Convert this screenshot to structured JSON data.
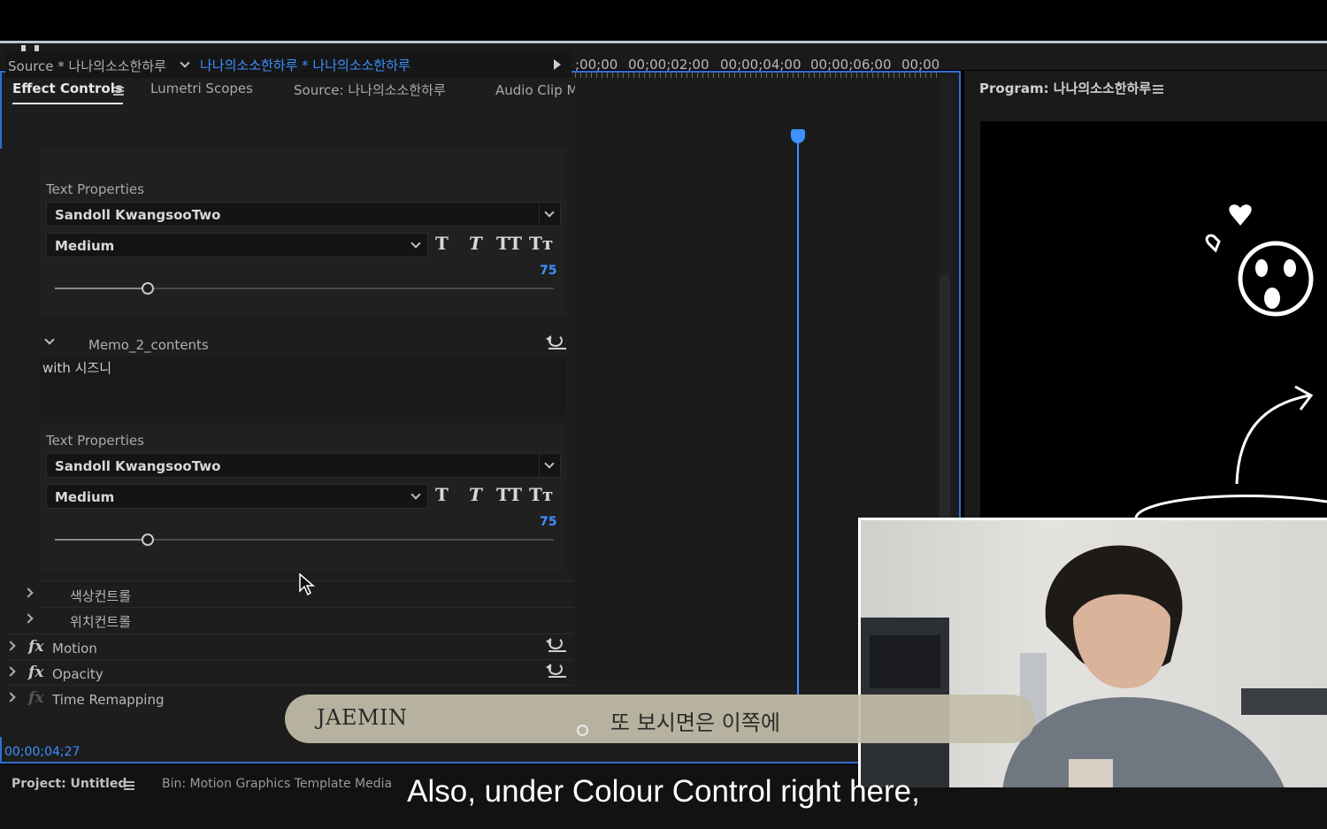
{
  "tabs": {
    "effect_controls": "Effect Controls",
    "lumetri": "Lumetri Scopes",
    "source": "Source: 나나의소소한하루",
    "audio_mixer": "Audio Clip Mixer: 나나의소소한하루"
  },
  "source_row": {
    "source_label": "Source * 나나의소소한하루",
    "sequence_label": "나나의소소한하루 * 나나의소소한하루"
  },
  "ruler": {
    "tc0": ";00;00",
    "tc1": "00;00;02;00",
    "tc2": "00;00;04;00",
    "tc3": "00;00;06;00",
    "tc4": "00;00"
  },
  "memo1": {
    "text_properties": "Text Properties",
    "font": "Sandoll KwangsooTwo",
    "style": "Medium",
    "size": "75"
  },
  "memo2": {
    "label": "Memo_2_contents",
    "content": "with 시즈니",
    "text_properties": "Text Properties",
    "font": "Sandoll KwangsooTwo",
    "style": "Medium",
    "size": "75"
  },
  "format_buttons": {
    "bold": "T",
    "italic": "T",
    "all_caps": "TT",
    "small_caps": "Tт"
  },
  "groups": {
    "color_control": "색상컨트롤",
    "position_control": "위치컨트롤"
  },
  "effects": {
    "fx": "fx",
    "motion": "Motion",
    "opacity": "Opacity",
    "time_remapping": "Time Remapping"
  },
  "status": {
    "timecode": "00;00;04;27"
  },
  "bottom": {
    "project": "Project: Untitled",
    "bin": "Bin: Motion Graphics Template Media"
  },
  "program": {
    "title": "Program: 나나의소소한하루"
  },
  "lower_third": {
    "name": "JAEMIN",
    "line": "또 보시면은 이쪽에"
  },
  "subtitle": "Also, under Colour Control right here,"
}
